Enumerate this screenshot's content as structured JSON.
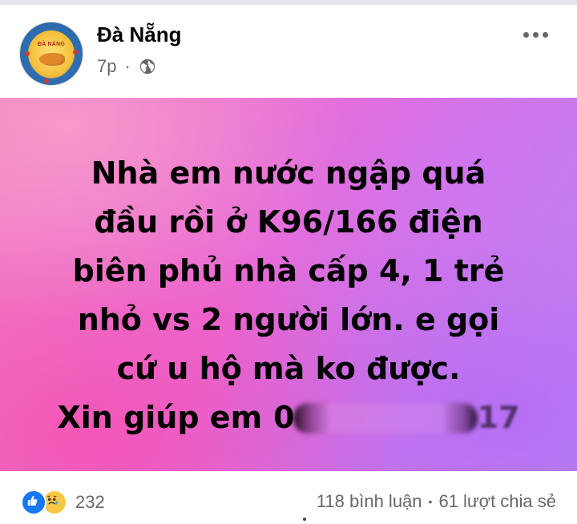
{
  "post": {
    "page_name": "Đà Nẵng",
    "avatar_text": "ĐÀ NẴNG",
    "time": "7p",
    "separator": "·",
    "privacy_icon": "globe-icon",
    "more_icon": "more-options-icon",
    "text_lines": [
      "Nhà em nước ngập quá",
      "đầu rồi ở K96/166 điện",
      "biên phủ nhà cấp 4, 1 trẻ",
      "nhỏ vs 2 người lớn. e gọi",
      "cứ u hộ mà ko được."
    ],
    "last_line": "Xin giúp em",
    "phone_partial_start": "0",
    "phone_partial_end": "17",
    "background_colors": [
      "#f27ac0",
      "#e86ad6",
      "#c97ae8",
      "#b986f0"
    ]
  },
  "footer": {
    "reaction_icons": [
      "like-icon",
      "sad-icon"
    ],
    "reaction_count": "232",
    "comments": "118 bình luận",
    "dot": "•",
    "shares": "61 lượt chia sẻ"
  }
}
